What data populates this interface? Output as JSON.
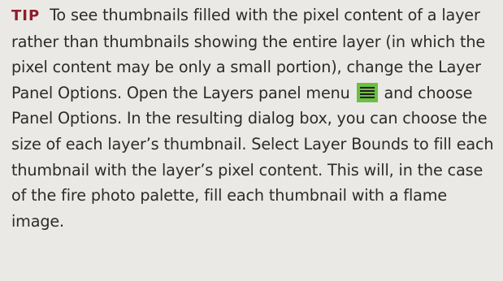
{
  "tip": {
    "label": "TIP",
    "text_before_icon": "To see thumbnails filled with the pixel content of a layer rather than thumbnails showing the entire layer (in which the pixel content may be only a small portion), change the Layer Panel Options. Open the Layers panel menu",
    "icon": "panel-menu-icon",
    "text_after_icon": "and choose Panel Options. In the resulting dialog box, you can choose the size of each layer’s thumbnail. Select Layer Bounds to fill each thumbnail with the layer’s pixel content. This will, in the case of the fire photo palette, fill each thumbnail with a flame image."
  },
  "colors": {
    "background": "#ebe9e5",
    "tip_label": "#8c1d2a",
    "icon_background": "#6cbf44"
  }
}
